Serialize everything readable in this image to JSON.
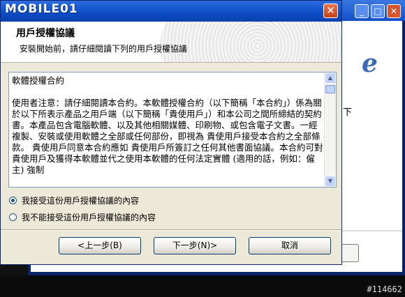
{
  "background_window": {
    "side_text": "下",
    "logo_char": "e"
  },
  "dialog": {
    "logo_text": "MOBILE01",
    "close_glyph": "✕",
    "header_title": "用戶授權協議",
    "header_subtitle": "安裝開始前，請仔細閱讀下列的用戶授權協議",
    "license_text": "軟體授權合約\n\n使用者注意：請仔細閱讀本合約。本軟體授權合約（以下簡稱「本合約」）係為關於以下所表示產品之用戶端（以下簡稱「貴使用戶」）和本公司之間所締結的契約書。本產品包含電腦軟體、以及其他相關媒體、印刷物、或包含電子文書。一經複製、安裝或使用軟體之全部或任何部份，即視為 貴使用戶接受本合約之全部條款。 貴使用戶同意本合約應如 貴使用戶所簽訂之任何其他書面協議。本合約可對 貴使用戶及獲得本軟體並代之使用本軟體的任何法定實體 (適用的話，例如：僱主) 強制",
    "radio_accept": "我接受這份用戶授權協議的內容",
    "radio_decline": "我不能接受這份用戶授權協議的內容",
    "btn_back": "<上一步(B)",
    "btn_next": "下一步(N)>",
    "btn_cancel": "取消"
  },
  "watermark": "#114662"
}
